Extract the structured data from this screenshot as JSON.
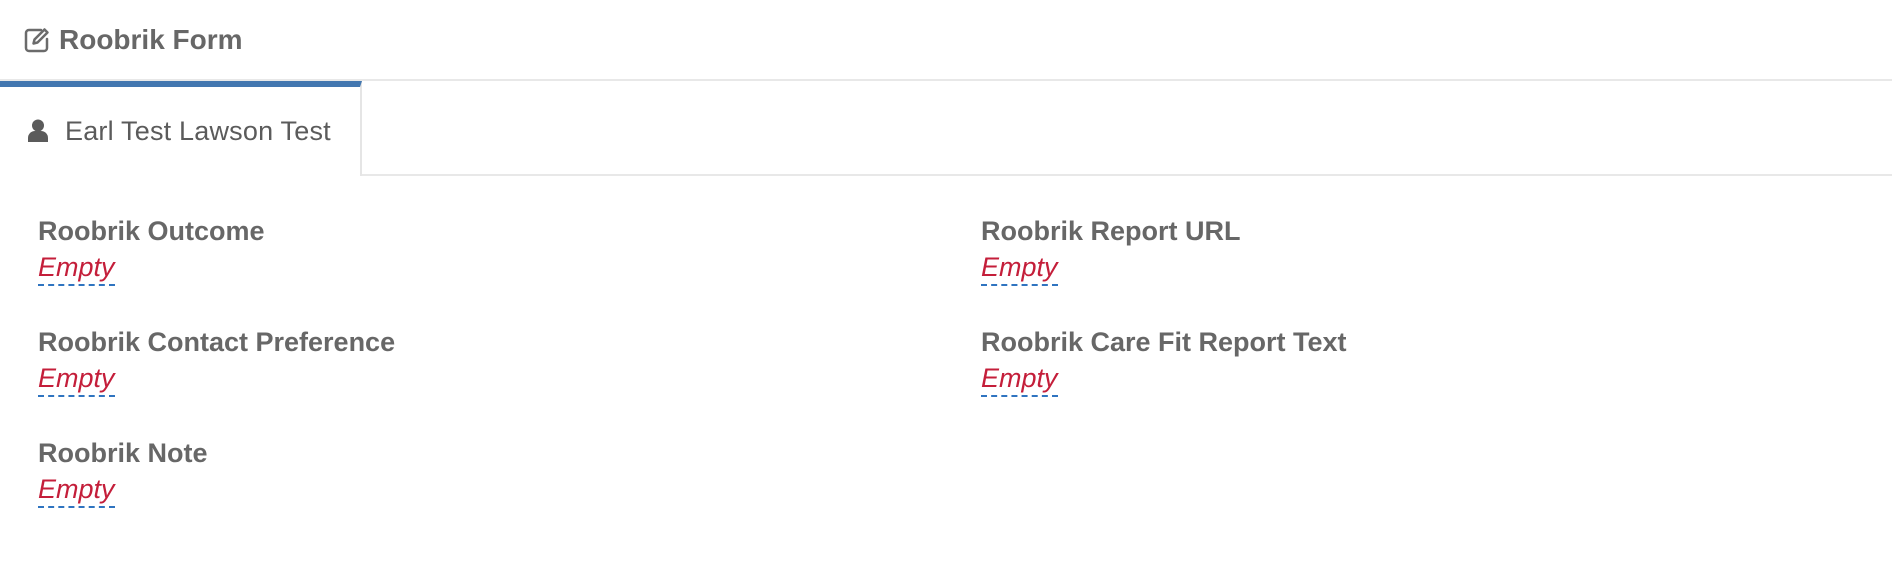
{
  "header": {
    "title": "Roobrik Form"
  },
  "tabs": [
    {
      "label": "Earl Test Lawson Test"
    }
  ],
  "fields": [
    {
      "label": "Roobrik Outcome",
      "value": "Empty"
    },
    {
      "label": "Roobrik Report URL",
      "value": "Empty"
    },
    {
      "label": "Roobrik Contact Preference",
      "value": "Empty"
    },
    {
      "label": "Roobrik Care Fit Report Text",
      "value": "Empty"
    },
    {
      "label": "Roobrik Note",
      "value": "Empty"
    }
  ],
  "colors": {
    "active_tab_accent": "#4377b0",
    "empty_value": "#c41e3a",
    "editable_underline": "#2f74c0",
    "label_text": "#676767"
  },
  "icons": {
    "header": "edit-icon",
    "tab": "user-icon"
  }
}
